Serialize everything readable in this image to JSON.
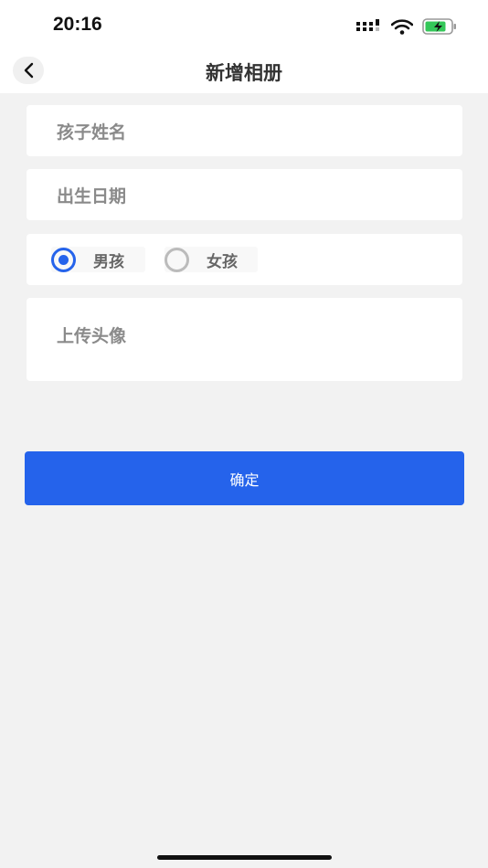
{
  "status": {
    "time": "20:16"
  },
  "nav": {
    "title": "新增相册",
    "back_icon": "chevron-left-icon"
  },
  "form": {
    "name_placeholder": "孩子姓名",
    "birth_placeholder": "出生日期",
    "gender_options": [
      {
        "label": "男孩",
        "selected": true
      },
      {
        "label": "女孩",
        "selected": false
      }
    ],
    "avatar_label": "上传头像"
  },
  "confirm_label": "确定",
  "colors": {
    "accent": "#2563eb",
    "radio_on": "#2563eb",
    "radio_off": "#bbbbbb",
    "battery": "#34c759"
  }
}
